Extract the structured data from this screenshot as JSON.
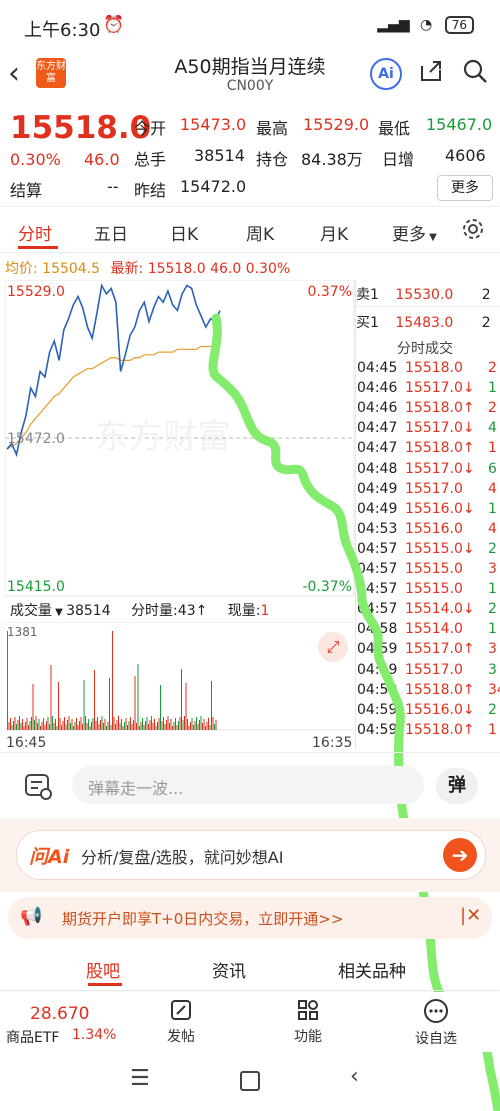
{
  "status_bar": {
    "time": "上午6:30",
    "battery": "76"
  },
  "header": {
    "title": "A50期指当月连续",
    "code": "CN00Y",
    "logo_text": "东方财富",
    "ai_label": "Ai"
  },
  "quote": {
    "price": "15518.0",
    "pct": "0.30%",
    "change": "46.0",
    "open_label": "今开",
    "open": "15473.0",
    "high_label": "最高",
    "high": "15529.0",
    "low_label": "最低",
    "low": "15467.0",
    "volume_label": "总手",
    "volume": "38514",
    "oi_label": "持仓",
    "oi": "84.38万",
    "daily_inc_label": "日增",
    "daily_inc": "4606",
    "settle_label": "结算",
    "settle": "--",
    "prev_settle_label": "昨结",
    "prev_settle": "15472.0",
    "more_label": "更多"
  },
  "tabs": [
    "分时",
    "五日",
    "日K",
    "周K",
    "月K",
    "更多"
  ],
  "avg_row": {
    "avg_label": "均价:",
    "avg_value": "15504.5",
    "latest_label": "最新:",
    "latest_value": "15518.0",
    "latest_change": "46.0",
    "latest_pct": "0.30%"
  },
  "chart_data": {
    "type": "line",
    "x_range": [
      "16:45",
      "16:35"
    ],
    "ylim": [
      15415.0,
      15529.0
    ],
    "y_top_label": "15529.0",
    "y_mid_label": "15472.0",
    "y_bottom_label": "15415.0",
    "pct_top_label": "0.37%",
    "pct_bottom_label": "-0.37%",
    "watermark": "东方财富",
    "series": [
      {
        "values": [
          15468,
          15470,
          15466,
          15474,
          15480,
          15490,
          15487,
          15496,
          15494,
          15503,
          15507,
          15500,
          15511,
          15515,
          15520,
          15523,
          15519,
          15512,
          15508,
          15517,
          15527,
          15524,
          15526,
          15521,
          15496,
          15502,
          15509,
          15512,
          15518,
          15521,
          15514,
          15519,
          15523,
          15521,
          15525,
          15520,
          15518,
          15524,
          15527,
          15526,
          15520,
          15516,
          15512,
          15515,
          15514,
          15518
        ]
      },
      {
        "values": [
          15468,
          15469,
          15470,
          15472,
          15474,
          15477,
          15479,
          15481,
          15483,
          15485,
          15487,
          15488,
          15490,
          15492,
          15494,
          15495,
          15496,
          15497,
          15497,
          15498,
          15499,
          15500,
          15501,
          15501,
          15500,
          15500,
          15500,
          15501,
          15501,
          15502,
          15502,
          15502,
          15503,
          15503,
          15503,
          15503,
          15504,
          15504,
          15504,
          15504,
          15504,
          15505,
          15505,
          15505,
          15505,
          15504.5
        ]
      }
    ]
  },
  "volume_panel": {
    "volume_label": "成交量",
    "volume_value": "38514",
    "tick_label": "分时量:",
    "tick_value": "43↑",
    "now_label": "现量:",
    "now_value": "1",
    "max_label": "1381",
    "start_time": "16:45",
    "end_time": "16:35"
  },
  "order_book": [
    {
      "label": "卖1",
      "price": "15530.0",
      "qty": "2"
    },
    {
      "label": "买1",
      "price": "15483.0",
      "qty": "2"
    }
  ],
  "trades_title": "分时成交",
  "trades": [
    {
      "time": "04:45",
      "price": "15518.0",
      "arrow": "",
      "qty": "2",
      "color": "red"
    },
    {
      "time": "04:46",
      "price": "15517.0",
      "arrow": "↓",
      "qty": "1",
      "color": "red"
    },
    {
      "time": "04:46",
      "price": "15518.0",
      "arrow": "↑",
      "qty": "2",
      "color": "red"
    },
    {
      "time": "04:47",
      "price": "15517.0",
      "arrow": "↓",
      "qty": "4",
      "color": "red"
    },
    {
      "time": "04:47",
      "price": "15518.0",
      "arrow": "↑",
      "qty": "1",
      "color": "red"
    },
    {
      "time": "04:48",
      "price": "15517.0",
      "arrow": "↓",
      "qty": "6",
      "color": "red"
    },
    {
      "time": "04:49",
      "price": "15517.0",
      "arrow": "",
      "qty": "4",
      "color": "red"
    },
    {
      "time": "04:49",
      "price": "15516.0",
      "arrow": "↓",
      "qty": "1",
      "color": "red"
    },
    {
      "time": "04:53",
      "price": "15516.0",
      "arrow": "",
      "qty": "4",
      "color": "red"
    },
    {
      "time": "04:57",
      "price": "15515.0",
      "arrow": "↓",
      "qty": "2",
      "color": "red"
    },
    {
      "time": "04:57",
      "price": "15515.0",
      "arrow": "",
      "qty": "3",
      "color": "red"
    },
    {
      "time": "04:57",
      "price": "15515.0",
      "arrow": "",
      "qty": "1",
      "color": "red"
    },
    {
      "time": "04:57",
      "price": "15514.0",
      "arrow": "↓",
      "qty": "2",
      "color": "red"
    },
    {
      "time": "04:58",
      "price": "15514.0",
      "arrow": "",
      "qty": "1",
      "color": "red"
    },
    {
      "time": "04:59",
      "price": "15517.0",
      "arrow": "↑",
      "qty": "3",
      "color": "red"
    },
    {
      "time": "04:59",
      "price": "15517.0",
      "arrow": "",
      "qty": "3",
      "color": "red"
    },
    {
      "time": "04:59",
      "price": "15518.0",
      "arrow": "↑",
      "qty": "34",
      "color": "red"
    },
    {
      "time": "04:59",
      "price": "15516.0",
      "arrow": "↓",
      "qty": "2",
      "color": "red"
    },
    {
      "time": "04:59",
      "price": "15518.0",
      "arrow": "↑",
      "qty": "1",
      "color": "red"
    }
  ],
  "danmu": {
    "placeholder": "弹幕走一波...",
    "button": "弹"
  },
  "ai_bar": {
    "brand": "问Ai",
    "text": "分析/复盘/选股，就问妙想AI"
  },
  "promo": {
    "text": "期货开户即享T+0日内交易，立即开通>>"
  },
  "bottom_tabs": [
    "股吧",
    "资讯",
    "相关品种"
  ],
  "dock": {
    "etf_price": "28.670",
    "etf_name": "商品ETF",
    "etf_pct": "1.34%",
    "post": "发帖",
    "func": "功能",
    "watch": "设自选"
  },
  "colors": {
    "up": "#e0301e",
    "down": "#1a9a3a",
    "price_line": "#2a62b8",
    "avg_line": "#e89a2a",
    "overlay": "#7dea6a"
  }
}
